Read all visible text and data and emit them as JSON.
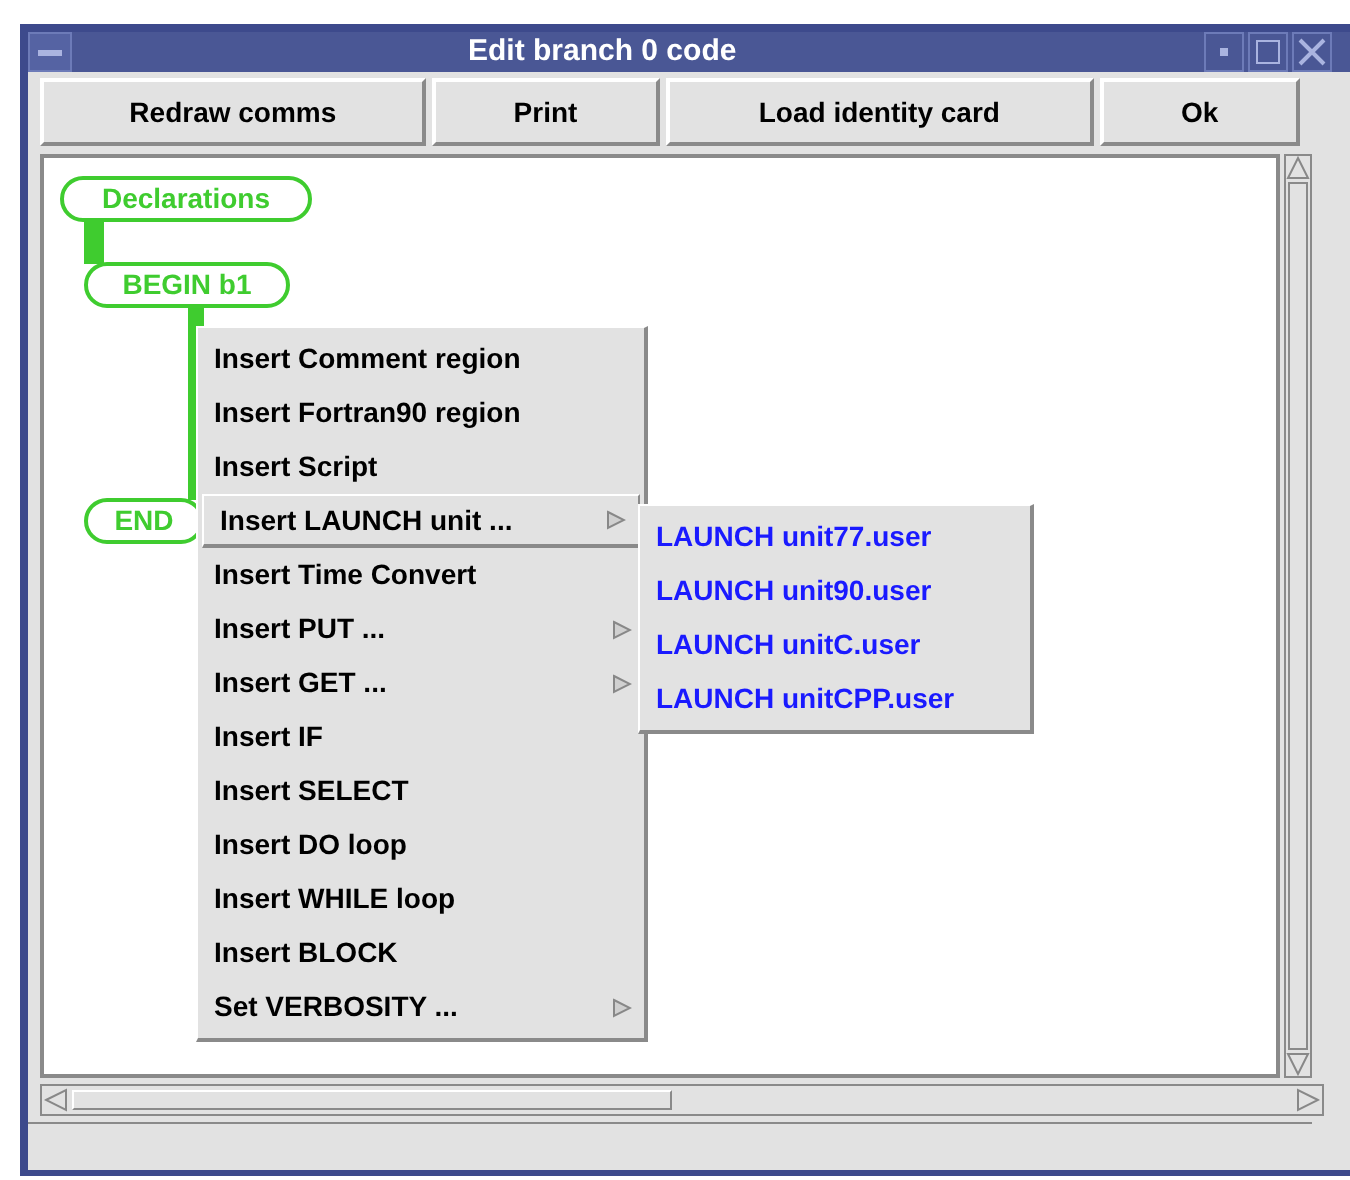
{
  "window": {
    "title": "Edit branch 0 code"
  },
  "toolbar": [
    "Redraw comms",
    "Print",
    "Load identity card",
    "Ok"
  ],
  "diagram": {
    "nodes": [
      {
        "label": "Declarations"
      },
      {
        "label": "BEGIN b1"
      },
      {
        "label": "END"
      }
    ]
  },
  "menu": {
    "items": [
      {
        "label": "Insert Comment region",
        "has_submenu": false,
        "selected": false
      },
      {
        "label": "Insert Fortran90 region",
        "has_submenu": false,
        "selected": false
      },
      {
        "label": "Insert Script",
        "has_submenu": false,
        "selected": false
      },
      {
        "label": "Insert LAUNCH unit ...",
        "has_submenu": true,
        "selected": true
      },
      {
        "label": "Insert Time Convert",
        "has_submenu": false,
        "selected": false
      },
      {
        "label": "Insert PUT ...",
        "has_submenu": true,
        "selected": false
      },
      {
        "label": "Insert GET ...",
        "has_submenu": true,
        "selected": false
      },
      {
        "label": "Insert IF",
        "has_submenu": false,
        "selected": false
      },
      {
        "label": "Insert SELECT",
        "has_submenu": false,
        "selected": false
      },
      {
        "label": "Insert DO loop",
        "has_submenu": false,
        "selected": false
      },
      {
        "label": "Insert WHILE loop",
        "has_submenu": false,
        "selected": false
      },
      {
        "label": "Insert BLOCK",
        "has_submenu": false,
        "selected": false
      },
      {
        "label": "Set VERBOSITY ...",
        "has_submenu": true,
        "selected": false
      }
    ]
  },
  "submenu": {
    "items": [
      "LAUNCH unit77.user",
      "LAUNCH unit90.user",
      "LAUNCH unitC.user",
      "LAUNCH unitCPP.user"
    ]
  }
}
